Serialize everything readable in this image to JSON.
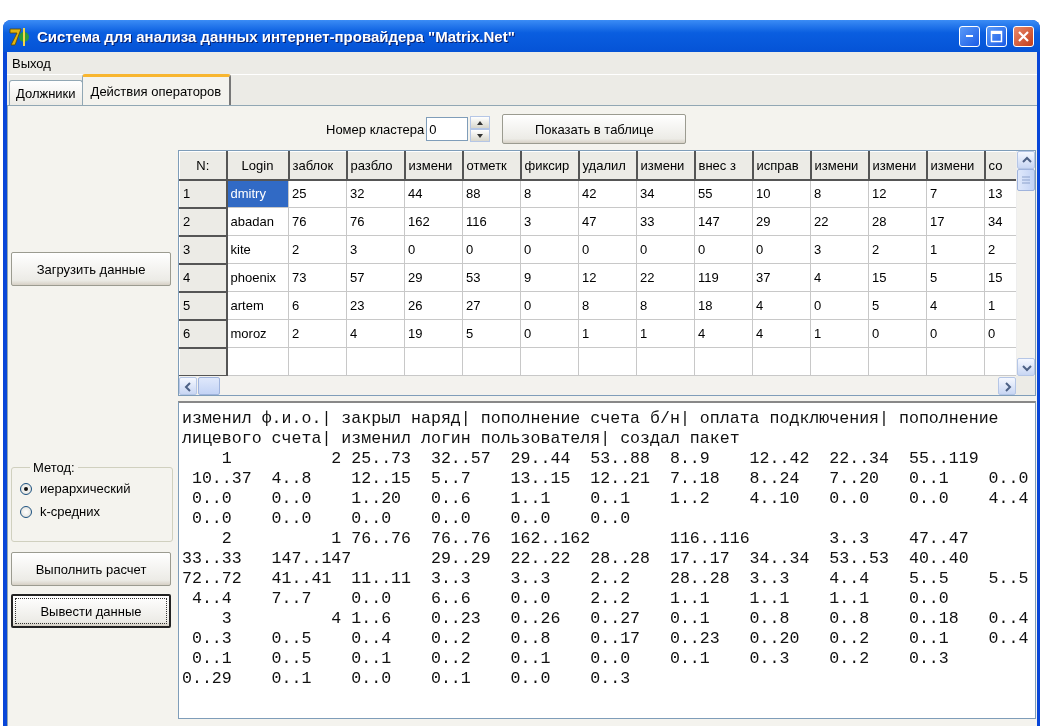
{
  "window": {
    "title": "Система для анализа данных интернет-провайдера \"Matrix.Net\""
  },
  "menu": [
    "Выход"
  ],
  "tabs": [
    {
      "label": "Должники",
      "selected": false
    },
    {
      "label": "Действия операторов",
      "selected": true
    }
  ],
  "cluster": {
    "label": "Номер кластера",
    "value": "0"
  },
  "show_button": "Показать в таблице",
  "load_button": {
    "label": "Загрузить данные",
    "focused": false
  },
  "method": {
    "title": "Метод:",
    "options": [
      {
        "label": "иерархический",
        "selected": true
      },
      {
        "label": "k-средних",
        "selected": false
      }
    ]
  },
  "action_buttons": [
    {
      "label": "Выполнить расчет",
      "focused": false
    },
    {
      "label": "Вывести данные",
      "focused": true
    }
  ],
  "table": {
    "columns": [
      "N:",
      "Login",
      "заблок",
      "разбло",
      "измени",
      "отметк",
      "фиксир",
      "удалил",
      "измени",
      "внес з",
      "исправ",
      "измени",
      "измени",
      "измени",
      "со"
    ],
    "rows": [
      {
        "n": "1",
        "login": "dmitry",
        "selected": true,
        "values": [
          "25",
          "32",
          "44",
          "88",
          "8",
          "42",
          "34",
          "55",
          "10",
          "8",
          "12",
          "7",
          "13"
        ]
      },
      {
        "n": "2",
        "login": "abadan",
        "selected": false,
        "values": [
          "76",
          "76",
          "162",
          "116",
          "3",
          "47",
          "33",
          "147",
          "29",
          "22",
          "28",
          "17",
          "34"
        ]
      },
      {
        "n": "3",
        "login": "kite",
        "selected": false,
        "values": [
          "2",
          "3",
          "0",
          "0",
          "0",
          "0",
          "0",
          "0",
          "0",
          "3",
          "2",
          "1",
          "2"
        ]
      },
      {
        "n": "4",
        "login": "phoenix",
        "selected": false,
        "values": [
          "73",
          "57",
          "29",
          "53",
          "9",
          "12",
          "22",
          "119",
          "37",
          "4",
          "15",
          "5",
          "15"
        ]
      },
      {
        "n": "5",
        "login": "artem",
        "selected": false,
        "values": [
          "6",
          "23",
          "26",
          "27",
          "0",
          "8",
          "8",
          "18",
          "4",
          "0",
          "5",
          "4",
          "1"
        ]
      },
      {
        "n": "6",
        "login": "moroz",
        "selected": false,
        "values": [
          "2",
          "4",
          "19",
          "5",
          "0",
          "1",
          "1",
          "4",
          "4",
          "1",
          "0",
          "0",
          "0"
        ]
      }
    ]
  },
  "output": {
    "lines": [
      "изменил ф.и.о.| закрыл наряд| пополнение счета б/н| оплата подключения| пополнение",
      "лицевого счета| изменил логин пользователя| создал пакет",
      "    1          2 25..73  32..57  29..44  53..88  8..9    12..42  22..34  55..119",
      " 10..37  4..8    12..15  5..7    13..15  12..21  7..18   8..24   7..20   0..1    0..0",
      " 0..0    0..0    1..20   0..6    1..1    0..1    1..2    4..10   0..0    0..0    4..4",
      " 0..0    0..0    0..0    0..0    0..0    0..0",
      "    2          1 76..76  76..76  162..162        116..116        3..3    47..47",
      "33..33   147..147        29..29  22..22  28..28  17..17  34..34  53..53  40..40",
      "72..72   41..41  11..11  3..3    3..3    2..2    28..28  3..3    4..4    5..5    5..5",
      " 4..4    7..7    0..0    6..6    0..0    2..2    1..1    1..1    1..1    0..0",
      "    3          4 1..6    0..23   0..26   0..27   0..1    0..8    0..8    0..18   0..4",
      " 0..3    0..5    0..4    0..2    0..8    0..17   0..23   0..20   0..2    0..1    0..4",
      " 0..1    0..5    0..1    0..2    0..1    0..0    0..1    0..3    0..2    0..3",
      "0..29    0..1    0..0    0..1    0..0    0..3"
    ]
  }
}
